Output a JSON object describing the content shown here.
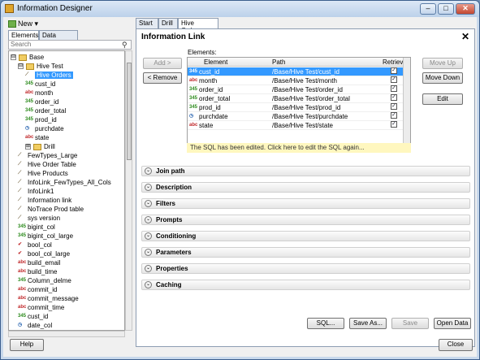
{
  "window": {
    "title": "Information Designer",
    "min": "‒",
    "max": "□",
    "close": "✕"
  },
  "left": {
    "new_label": "New",
    "tabs": [
      "Elements",
      "Data Sources"
    ],
    "search_placeholder": "Search",
    "tree": [
      {
        "label": "Base",
        "kind": "folder",
        "toggle": "⊟",
        "indent": 0
      },
      {
        "label": "Hive Test",
        "kind": "folder",
        "toggle": "⊟",
        "indent": 1
      },
      {
        "label": "Hive Orders",
        "kind": "path",
        "indent": 2,
        "selected": true
      },
      {
        "label": "cust_id",
        "kind": "345",
        "indent": 2
      },
      {
        "label": "month",
        "kind": "abc",
        "indent": 2
      },
      {
        "label": "order_id",
        "kind": "345",
        "indent": 2
      },
      {
        "label": "order_total",
        "kind": "345",
        "indent": 2
      },
      {
        "label": "prod_id",
        "kind": "345",
        "indent": 2
      },
      {
        "label": "purchdate",
        "kind": "clock",
        "indent": 2
      },
      {
        "label": "state",
        "kind": "abc",
        "indent": 2
      },
      {
        "label": "Drill",
        "kind": "folder",
        "toggle": "⊞",
        "indent": 2
      },
      {
        "label": "FewTypes_Large",
        "kind": "path",
        "indent": 1
      },
      {
        "label": "Hive Order Table",
        "kind": "path",
        "indent": 1
      },
      {
        "label": "Hive Products",
        "kind": "path",
        "indent": 1
      },
      {
        "label": "InfoLink_FewTypes_All_Cols",
        "kind": "path",
        "indent": 1
      },
      {
        "label": "InfoLink1",
        "kind": "path",
        "indent": 1
      },
      {
        "label": "Information link",
        "kind": "path",
        "indent": 1
      },
      {
        "label": "NoTrace Prod table",
        "kind": "path",
        "indent": 1
      },
      {
        "label": "sys version",
        "kind": "path",
        "indent": 1
      },
      {
        "label": "bigint_col",
        "kind": "345",
        "indent": 1
      },
      {
        "label": "bigint_col_large",
        "kind": "345",
        "indent": 1
      },
      {
        "label": "bool_col",
        "kind": "bool",
        "indent": 1
      },
      {
        "label": "bool_col_large",
        "kind": "bool",
        "indent": 1
      },
      {
        "label": "build_email",
        "kind": "abc",
        "indent": 1
      },
      {
        "label": "build_time",
        "kind": "abc",
        "indent": 1
      },
      {
        "label": "Column_delme",
        "kind": "345",
        "indent": 1
      },
      {
        "label": "commit_id",
        "kind": "abc",
        "indent": 1
      },
      {
        "label": "commit_message",
        "kind": "abc",
        "indent": 1
      },
      {
        "label": "commit_time",
        "kind": "abc",
        "indent": 1
      },
      {
        "label": "cust_id",
        "kind": "345",
        "indent": 1
      },
      {
        "label": "date_col",
        "kind": "clock",
        "indent": 1
      }
    ]
  },
  "tabs": [
    "Start",
    "Drill",
    "Hive Orders"
  ],
  "panel": {
    "title": "Information Link",
    "close": "✕",
    "add": "Add >",
    "remove": "< Remove",
    "elements_label": "Elements:",
    "columns": [
      "Element",
      "Path",
      "Retrieve"
    ],
    "rows": [
      {
        "kind": "345",
        "element": "cust_id",
        "path": "/Base/Hive Test/cust_id",
        "check": "✓",
        "selected": true
      },
      {
        "kind": "abc",
        "element": "month",
        "path": "/Base/Hive Test/month",
        "check": "✓"
      },
      {
        "kind": "345",
        "element": "order_id",
        "path": "/Base/Hive Test/order_id",
        "check": "✓"
      },
      {
        "kind": "345",
        "element": "order_total",
        "path": "/Base/Hive Test/order_total",
        "check": "✓"
      },
      {
        "kind": "345",
        "element": "prod_id",
        "path": "/Base/Hive Test/prod_id",
        "check": "✓"
      },
      {
        "kind": "clock",
        "element": "purchdate",
        "path": "/Base/Hive Test/purchdate",
        "check": "✓"
      },
      {
        "kind": "abc",
        "element": "state",
        "path": "/Base/Hive Test/state",
        "check": "✓"
      }
    ],
    "notice": "The SQL has been edited. Click here to edit the SQL again...",
    "move_up": "Move Up",
    "move_down": "Move Down",
    "edit": "Edit",
    "sections": [
      "Join path",
      "Description",
      "Filters",
      "Prompts",
      "Conditioning",
      "Parameters",
      "Properties",
      "Caching"
    ],
    "chevron": "⌄",
    "sql": "SQL...",
    "save_as": "Save As...",
    "save": "Save",
    "open_data": "Open Data"
  },
  "help": "Help",
  "close": "Close",
  "glyphs": {
    "345": "345",
    "abc": "abc",
    "clock": "◷",
    "path": "⟋",
    "bool": "✔"
  }
}
